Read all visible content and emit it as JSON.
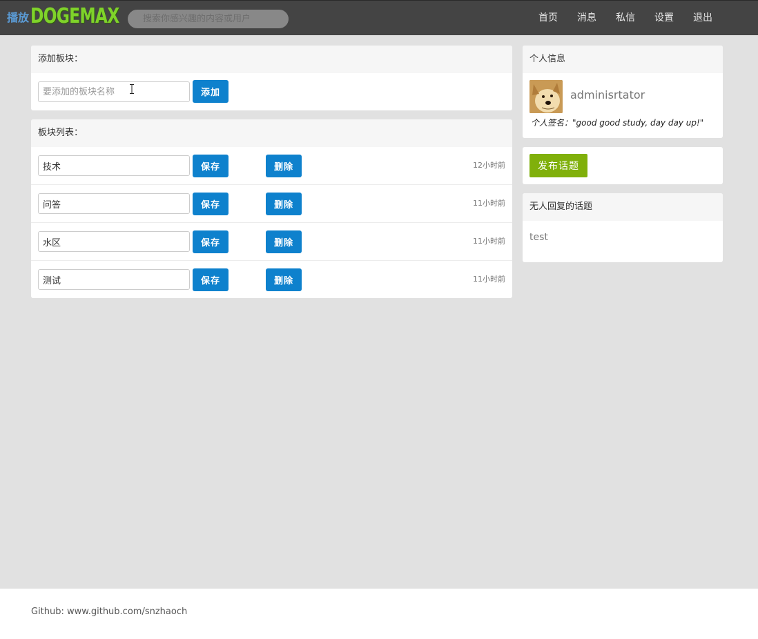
{
  "navbar": {
    "logo_play": "播放",
    "logo": "DOGEMAX",
    "search_placeholder": "搜索你感兴趣的内容或用户",
    "links": [
      "首页",
      "消息",
      "私信",
      "设置",
      "退出"
    ]
  },
  "add_section": {
    "title": "添加板块：",
    "input_placeholder": "要添加的板块名称",
    "add_label": "添加"
  },
  "list_section": {
    "title": "板块列表：",
    "save_label": "保存",
    "delete_label": "删除",
    "rows": [
      {
        "name": "技术",
        "time": "12小时前"
      },
      {
        "name": "问答",
        "time": "11小时前"
      },
      {
        "name": "水区",
        "time": "11小时前"
      },
      {
        "name": "测试",
        "time": "11小时前"
      }
    ]
  },
  "profile": {
    "title": "个人信息",
    "username": "adminisrtator",
    "signature": "个人签名：\"good good study, day day up!\""
  },
  "publish": {
    "label": "发布话题"
  },
  "unanswered": {
    "title": "无人回复的话题",
    "topics": [
      "test"
    ]
  },
  "footer": {
    "text": "Github: www.github.com/snzhaoch"
  },
  "colors": {
    "primary_button": "#0e81cd",
    "publish_button": "#80b00b",
    "navbar": "#444444",
    "logo": "#7fd22a"
  }
}
